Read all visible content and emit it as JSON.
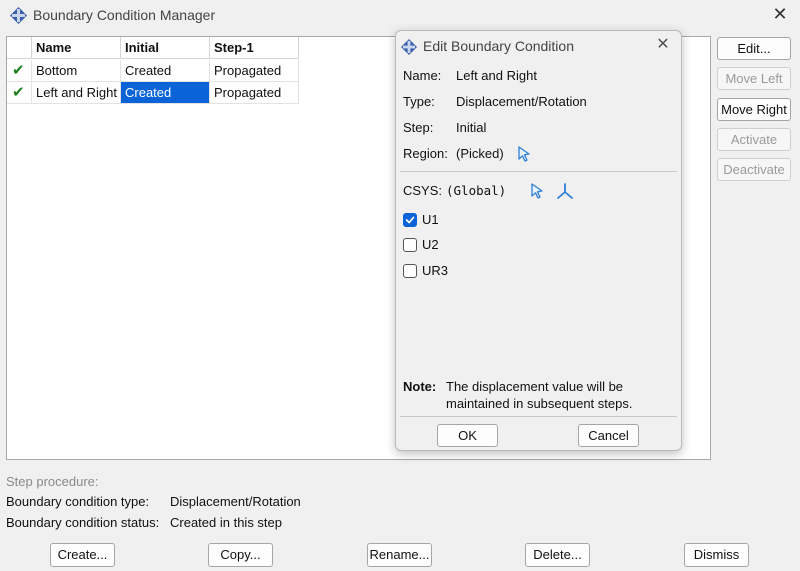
{
  "main": {
    "title": "Boundary Condition Manager",
    "close_glyph": "✕"
  },
  "table": {
    "columns": [
      "Name",
      "Initial",
      "Step-1"
    ],
    "rows": [
      {
        "check": "✔",
        "name": "Bottom",
        "initial": "Created",
        "step1": "Propagated"
      },
      {
        "check": "✔",
        "name": "Left and Right",
        "initial": "Created",
        "step1": "Propagated"
      }
    ]
  },
  "side_buttons": {
    "edit": "Edit...",
    "move_left": "Move Left",
    "move_right": "Move Right",
    "activate": "Activate",
    "deactivate": "Deactivate"
  },
  "info": {
    "step_procedure_label": "Step procedure:",
    "bc_type_label": "Boundary condition type:",
    "bc_type_value": "Displacement/Rotation",
    "bc_status_label": "Boundary condition status:",
    "bc_status_value": "Created in this step"
  },
  "bottom_buttons": {
    "create": "Create...",
    "copy": "Copy...",
    "rename": "Rename...",
    "delete": "Delete...",
    "dismiss": "Dismiss"
  },
  "dialog": {
    "title": "Edit Boundary Condition",
    "close_glyph": "✕",
    "name_label": "Name:",
    "name_value": "Left and Right",
    "type_label": "Type:",
    "type_value": "Displacement/Rotation",
    "step_label": "Step:",
    "step_value": "Initial",
    "region_label": "Region:",
    "region_value": "(Picked)",
    "csys_label": "CSYS:",
    "csys_value": "(Global)",
    "dofs": [
      {
        "label": "U1",
        "checked": true
      },
      {
        "label": "U2",
        "checked": false
      },
      {
        "label": "UR3",
        "checked": false
      }
    ],
    "note_label": "Note:",
    "note_line1": "The displacement value will be",
    "note_line2": "maintained in subsequent steps.",
    "ok_label": "OK",
    "cancel_label": "Cancel"
  },
  "colors": {
    "selection": "#0a64d8",
    "check": "#1a7f1a",
    "cursor_icon": "#2f7fd8"
  }
}
